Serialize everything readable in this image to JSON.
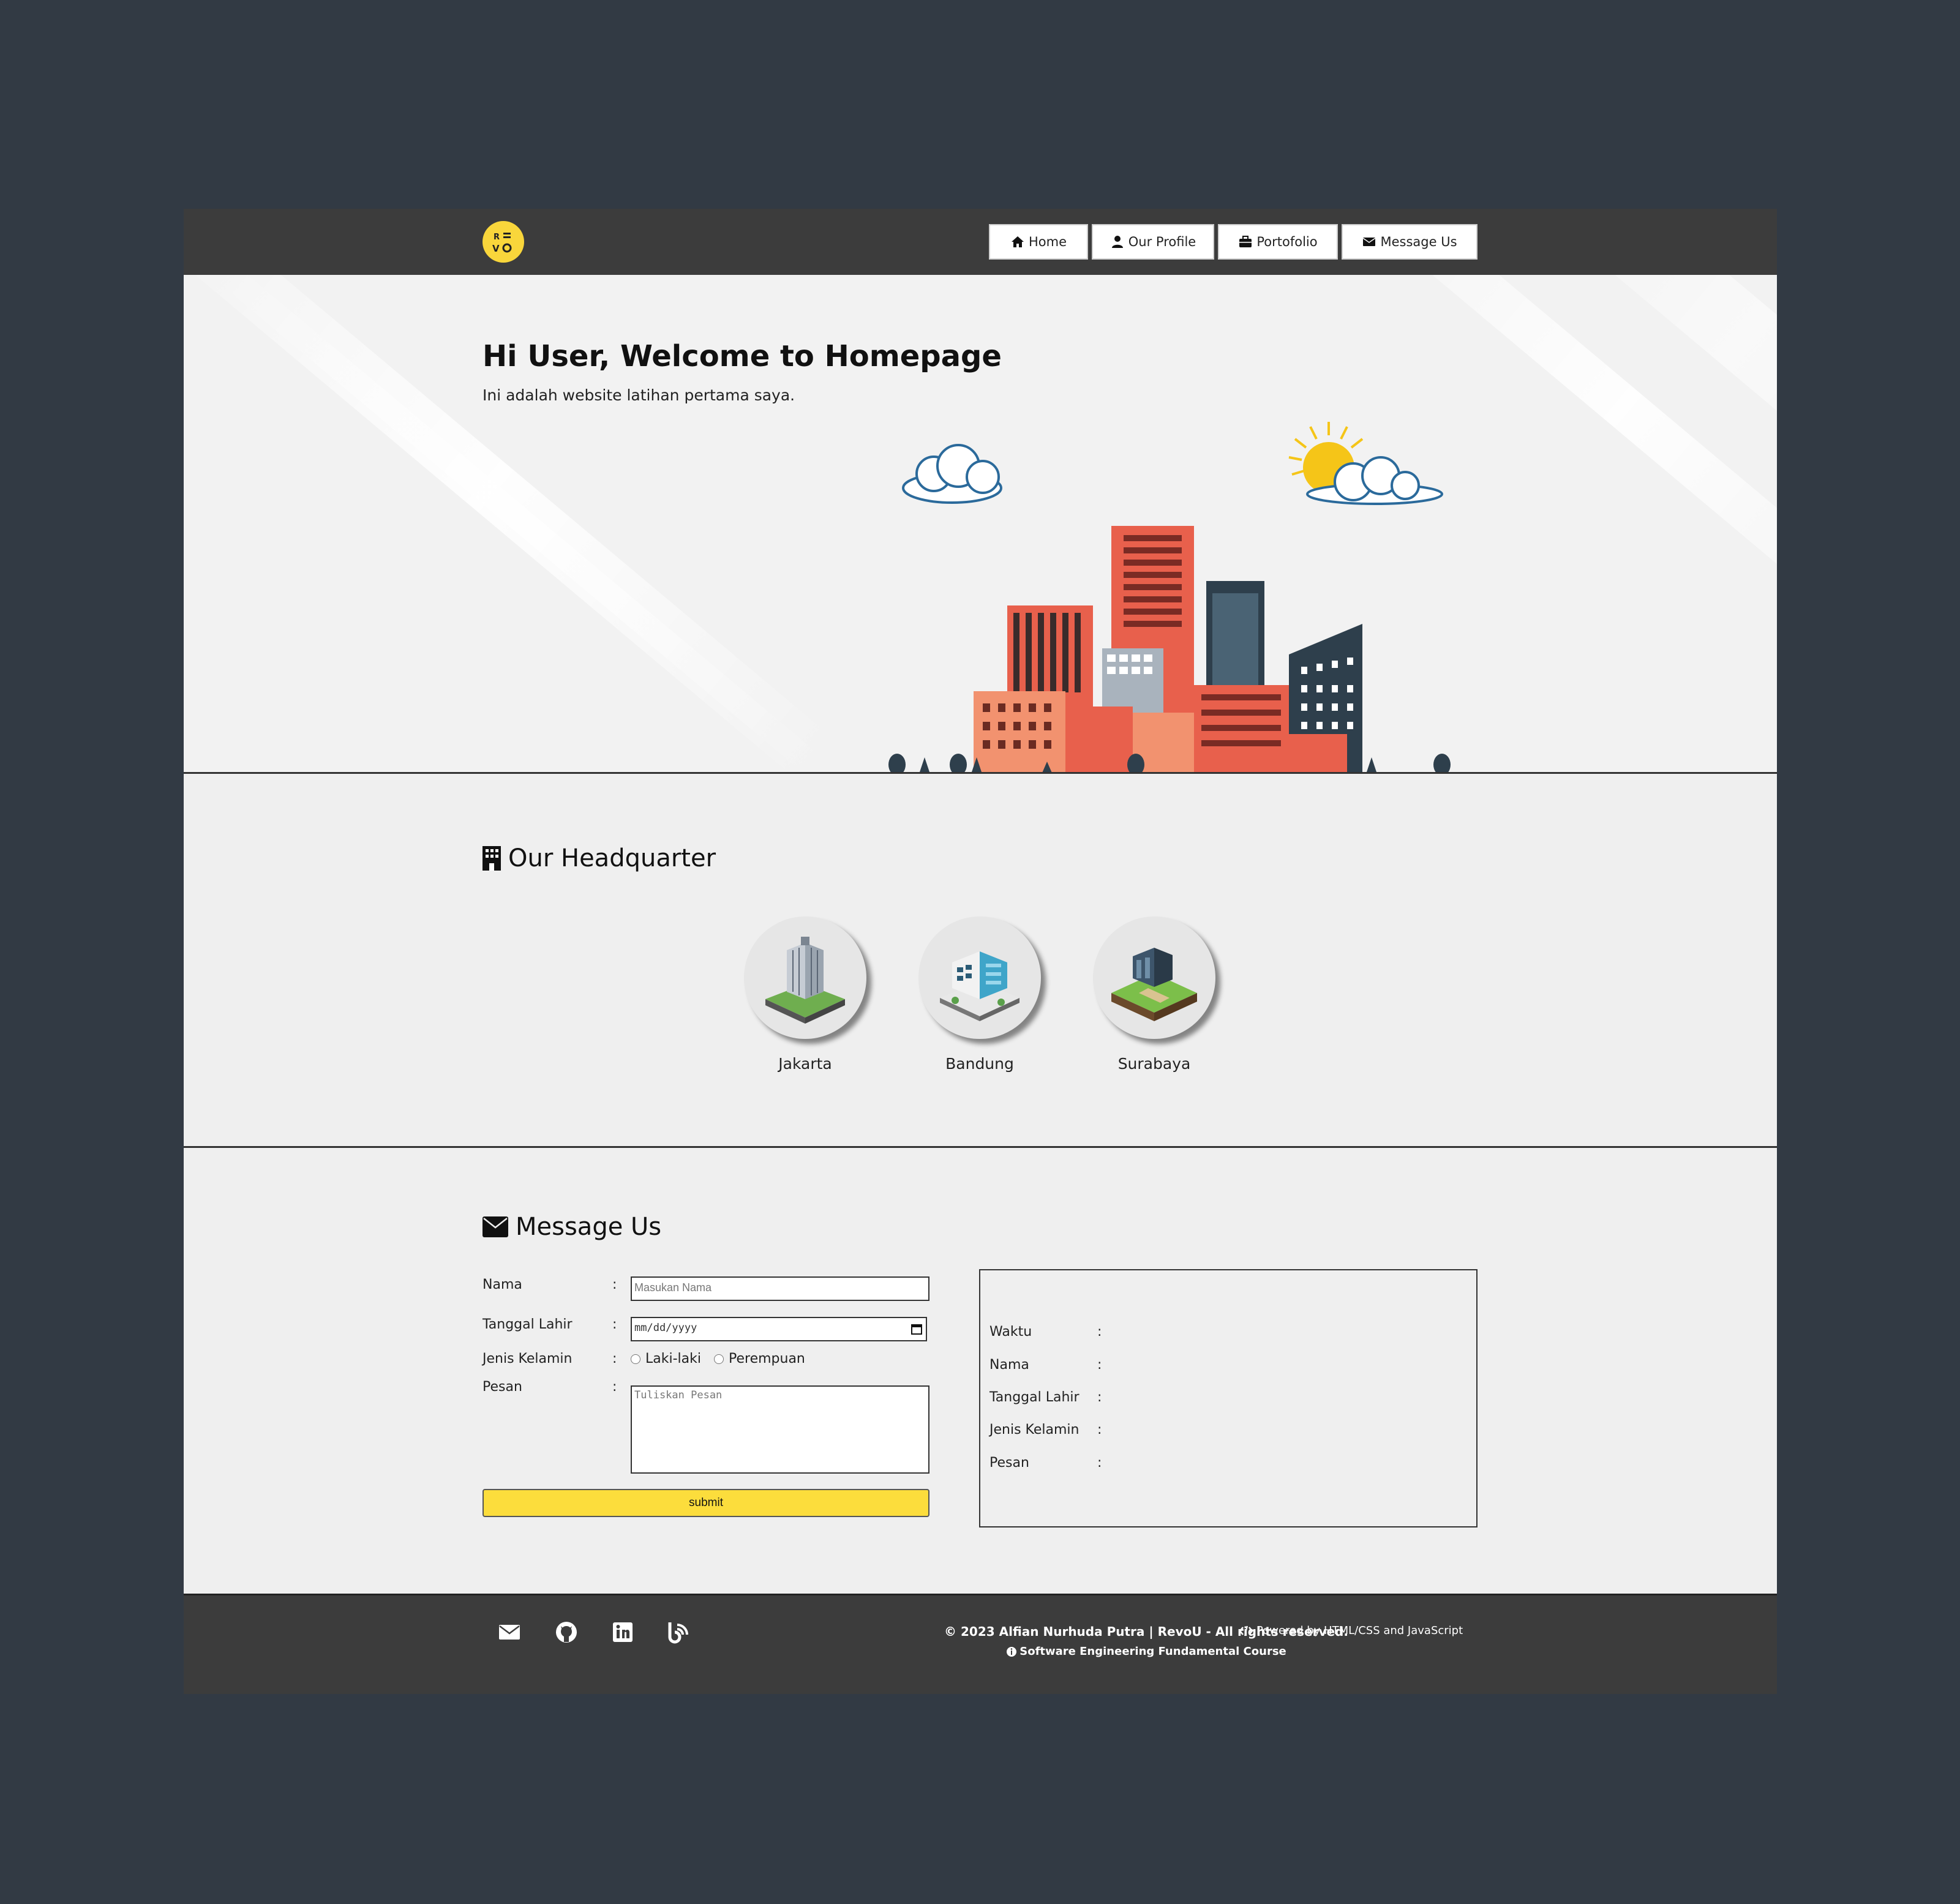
{
  "nav": {
    "logo_alt": "RV logo",
    "items": [
      {
        "label": "Home",
        "icon": "home-icon"
      },
      {
        "label": "Our Profile",
        "icon": "user-icon"
      },
      {
        "label": "Portofolio",
        "icon": "briefcase-icon"
      },
      {
        "label": "Message Us",
        "icon": "envelope-icon"
      }
    ]
  },
  "hero": {
    "title": "Hi User, Welcome to Homepage",
    "subtitle": "Ini adalah website latihan pertama saya."
  },
  "headquarter": {
    "title": "Our Headquarter",
    "cities": [
      "Jakarta",
      "Bandung",
      "Surabaya"
    ]
  },
  "message": {
    "title": "Message Us",
    "form": {
      "name_label": "Nama",
      "name_placeholder": "Masukan Nama",
      "dob_label": "Tanggal Lahir",
      "dob_placeholder": "mm/dd/yyyy",
      "gender_label": "Jenis Kelamin",
      "gender_options": [
        "Laki-laki",
        "Perempuan"
      ],
      "message_label": "Pesan",
      "message_placeholder": "Tuliskan Pesan",
      "colon": ":",
      "submit": "submit"
    },
    "result": {
      "labels": [
        "Waktu",
        "Nama",
        "Tanggal Lahir",
        "Jenis Kelamin",
        "Pesan"
      ],
      "colon": ":"
    }
  },
  "footer": {
    "copyright": "© 2023 Alfian Nurhuda Putra | RevoU - All rights reserved.",
    "course": "Software Engineering Fundamental Course",
    "powered": "Powered by HTML/CSS and JavaScript",
    "icons": [
      "envelope-icon",
      "github-icon",
      "linkedin-icon",
      "blog-icon"
    ]
  },
  "colors": {
    "background": "#323a44",
    "navbar": "#3c3c3c",
    "accent": "#fcdd3c",
    "content": "#efefef"
  }
}
